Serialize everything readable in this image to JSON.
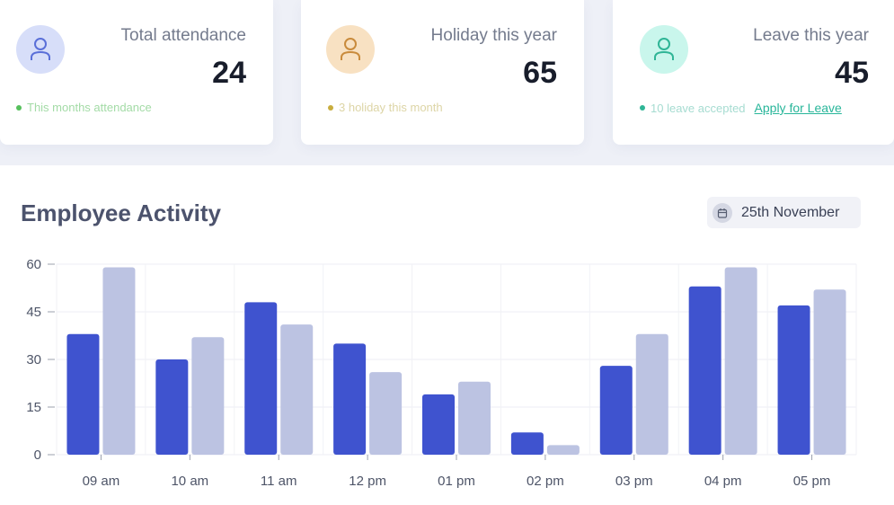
{
  "cards": [
    {
      "label": "Total attendance",
      "value": "24",
      "sub": "This months attendance"
    },
    {
      "label": "Holiday this year",
      "value": "65",
      "sub": "3 holiday this month"
    },
    {
      "label": "Leave this year",
      "value": "45",
      "sub": "10 leave accepted",
      "link": "Apply for Leave"
    }
  ],
  "activity": {
    "title": "Employee Activity",
    "date": "25th November"
  },
  "colors": {
    "series_a": "#3f53cf",
    "series_b": "#bcc3e2",
    "attendance_dot": "#56c05c",
    "holiday_dot": "#c8ad3e",
    "leave_dot": "#2fb596"
  },
  "icons": {
    "card_avatar": "person-icon",
    "date_chip": "calendar-icon"
  },
  "chart_data": {
    "type": "bar",
    "categories": [
      "09 am",
      "10 am",
      "11 am",
      "12 pm",
      "01 pm",
      "02 pm",
      "03 pm",
      "04 pm",
      "05 pm"
    ],
    "series": [
      {
        "values": [
          38,
          30,
          48,
          35,
          19,
          7,
          28,
          53,
          47
        ]
      },
      {
        "values": [
          59,
          37,
          41,
          26,
          23,
          3,
          38,
          59,
          52
        ]
      }
    ],
    "yticks": [
      0,
      15,
      30,
      45,
      60
    ],
    "ylim": [
      0,
      60
    ],
    "grid": true,
    "title": "",
    "xlabel": "",
    "ylabel": ""
  }
}
